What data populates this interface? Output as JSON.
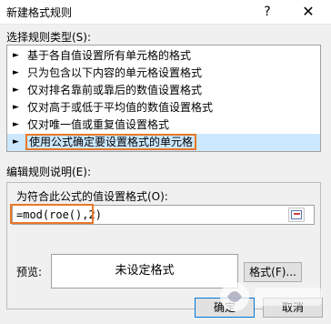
{
  "dialog": {
    "title": "新建格式规则",
    "help_glyph": "?",
    "close_glyph": "✕"
  },
  "rule_type": {
    "label": "选择规则类型(S):",
    "items": [
      {
        "label": "基于各自值设置所有单元格的格式"
      },
      {
        "label": "只为包含以下内容的单元格设置格式"
      },
      {
        "label": "仅对排名靠前或靠后的数值设置格式"
      },
      {
        "label": "仅对高于或低于平均值的数值设置格式"
      },
      {
        "label": "仅对唯一值或重复值设置格式"
      },
      {
        "label": "使用公式确定要设置格式的单元格"
      }
    ],
    "selected_index": 5,
    "arrow_glyph": "►"
  },
  "edit": {
    "label": "编辑规则说明(E):",
    "formula_label": "为符合此公式的值设置格式(O):",
    "formula_value": "=mod(roe(),2)"
  },
  "preview": {
    "label": "预览:",
    "text": "未设定格式"
  },
  "buttons": {
    "format": "格式(F)...",
    "ok": "确定",
    "cancel": "取消"
  },
  "colors": {
    "highlight_border": "#e8782a",
    "selected_row": "#cce8ff"
  },
  "watermark_icon": "watermark-logo-icon"
}
